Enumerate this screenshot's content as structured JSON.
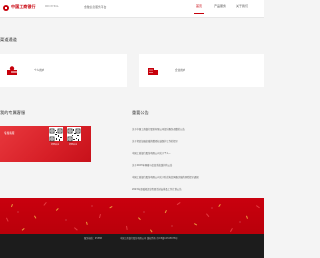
{
  "header": {
    "brand": "中国工商银行",
    "brand_sub": "INDUSTRIAL",
    "site_label": "金融信息服务平台",
    "nav": [
      "首页",
      "产品服务",
      "关于我们"
    ],
    "active_nav": 0
  },
  "channels": {
    "title": "渠道通道",
    "items": [
      {
        "label": "个人用户"
      },
      {
        "label": "企业用户"
      }
    ]
  },
  "service": {
    "title": "我的专属客服",
    "tag": "专属客服",
    "qr_labels": [
      "扫码关注",
      "扫码关注"
    ]
  },
  "notices": {
    "title": "重要公告",
    "items": [
      "关于中国工商银行股份有限公司部分服务调整的公告",
      "关于切实加强金融消费者权益保护工作的提示",
      "中国工商银行股份有限公司关于个人...",
      "关于2023年网络与信息系统维护的公告",
      "中国工商银行股份有限公司关于防范电信网络诈骗的风险提示通知",
      "2023年金融知识宣传周活动安排及工作计划公告"
    ]
  },
  "footer": {
    "left": "服务热线：95588",
    "right": "中国工商银行股份有限公司 版权所有 京ICP备12345678号"
  },
  "colors": {
    "brand_red": "#c7000b",
    "footer_bg": "#1c1c1c",
    "page_bg": "#f4f4f4"
  }
}
